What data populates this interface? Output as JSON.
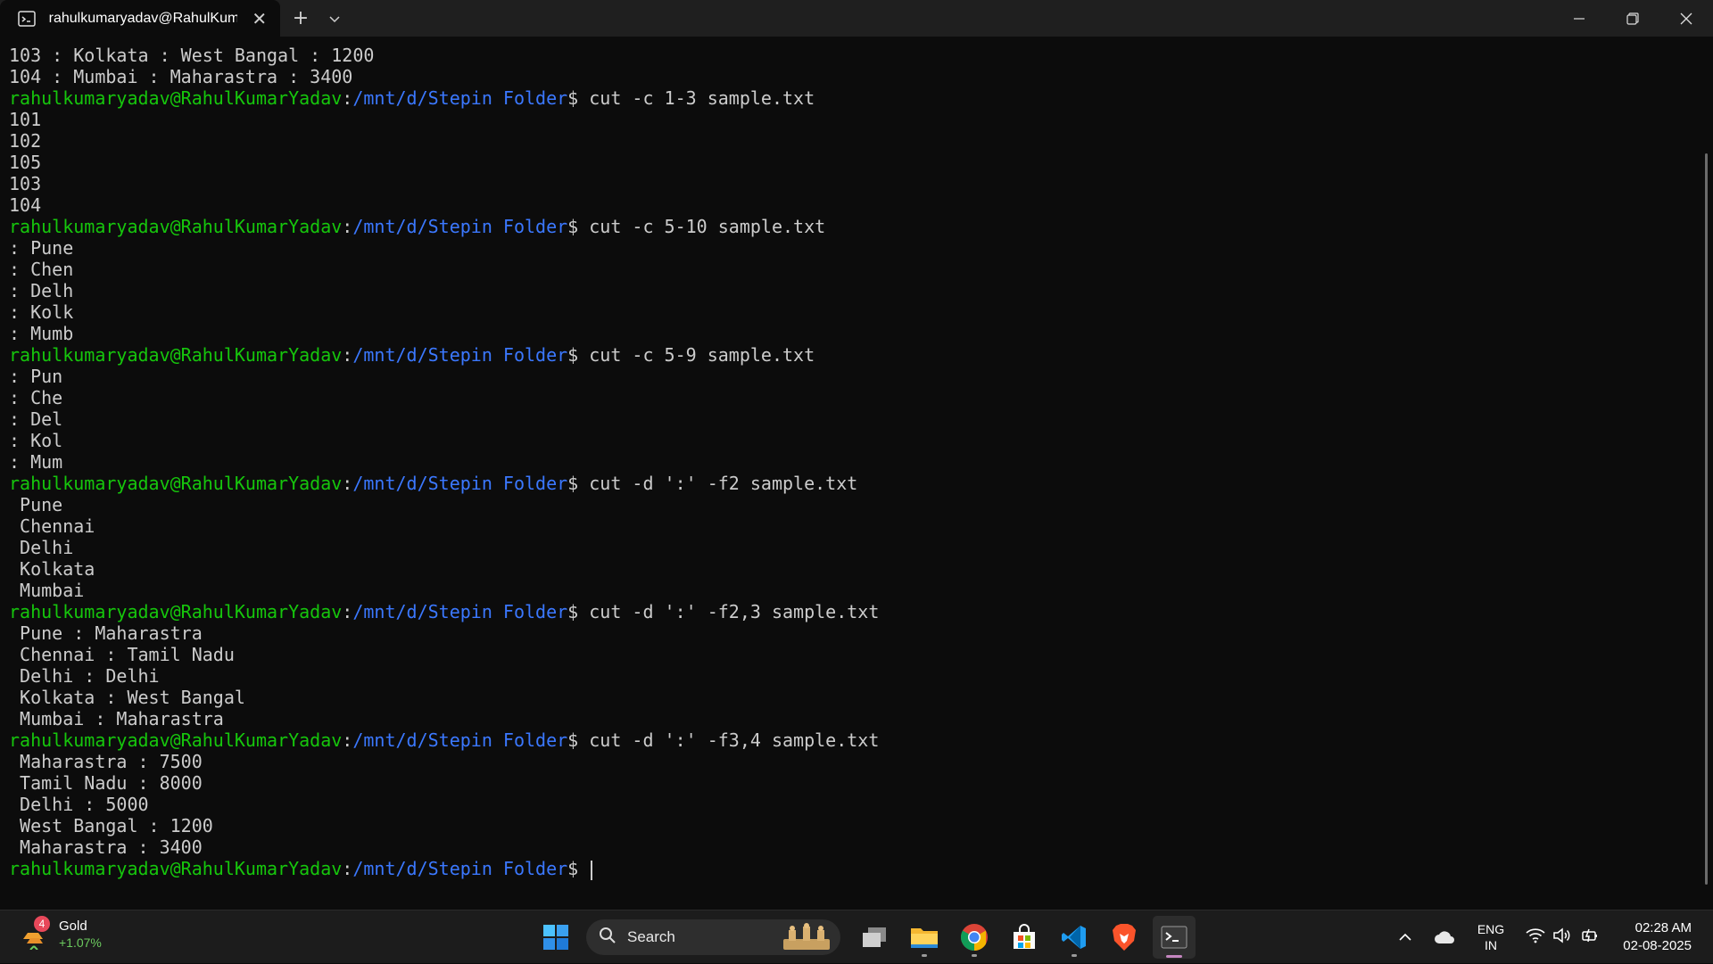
{
  "window": {
    "tab_title": "rahulkumaryadav@RahulKum",
    "tab_icon": "terminal-icon",
    "new_tab_label": "+",
    "dropdown_icon": "chevron-down-icon",
    "controls": [
      "minimize-icon",
      "restore-icon",
      "close-icon"
    ]
  },
  "prompt": {
    "user": "rahulkumaryadav@RahulKumarYadav",
    "sep": ":",
    "path": "/mnt/d/Stepin Folder",
    "symbol": "$ "
  },
  "terminal": {
    "lines": [
      {
        "type": "out",
        "text": "103 : Kolkata : West Bangal : 1200"
      },
      {
        "type": "out",
        "text": "104 : Mumbai : Maharastra : 3400"
      },
      {
        "type": "cmd",
        "text": "cut -c 1-3 sample.txt"
      },
      {
        "type": "out",
        "text": "101"
      },
      {
        "type": "out",
        "text": "102"
      },
      {
        "type": "out",
        "text": "105"
      },
      {
        "type": "out",
        "text": "103"
      },
      {
        "type": "out",
        "text": "104"
      },
      {
        "type": "cmd",
        "text": "cut -c 5-10 sample.txt"
      },
      {
        "type": "out",
        "text": ": Pune"
      },
      {
        "type": "out",
        "text": ": Chen"
      },
      {
        "type": "out",
        "text": ": Delh"
      },
      {
        "type": "out",
        "text": ": Kolk"
      },
      {
        "type": "out",
        "text": ": Mumb"
      },
      {
        "type": "cmd",
        "text": "cut -c 5-9 sample.txt"
      },
      {
        "type": "out",
        "text": ": Pun"
      },
      {
        "type": "out",
        "text": ": Che"
      },
      {
        "type": "out",
        "text": ": Del"
      },
      {
        "type": "out",
        "text": ": Kol"
      },
      {
        "type": "out",
        "text": ": Mum"
      },
      {
        "type": "cmd",
        "text": "cut -d ':' -f2 sample.txt"
      },
      {
        "type": "out",
        "text": " Pune"
      },
      {
        "type": "out",
        "text": " Chennai"
      },
      {
        "type": "out",
        "text": " Delhi"
      },
      {
        "type": "out",
        "text": " Kolkata"
      },
      {
        "type": "out",
        "text": " Mumbai"
      },
      {
        "type": "cmd",
        "text": "cut -d ':' -f2,3 sample.txt"
      },
      {
        "type": "out",
        "text": " Pune : Maharastra"
      },
      {
        "type": "out",
        "text": " Chennai : Tamil Nadu"
      },
      {
        "type": "out",
        "text": " Delhi : Delhi"
      },
      {
        "type": "out",
        "text": " Kolkata : West Bangal"
      },
      {
        "type": "out",
        "text": " Mumbai : Maharastra"
      },
      {
        "type": "cmd",
        "text": "cut -d ':' -f3,4 sample.txt"
      },
      {
        "type": "out",
        "text": " Maharastra : 7500"
      },
      {
        "type": "out",
        "text": " Tamil Nadu : 8000"
      },
      {
        "type": "out",
        "text": " Delhi : 5000"
      },
      {
        "type": "out",
        "text": " West Bangal : 1200"
      },
      {
        "type": "out",
        "text": " Maharastra : 3400"
      },
      {
        "type": "cmd",
        "text": "",
        "cursor": true
      }
    ]
  },
  "taskbar": {
    "widget": {
      "badge": "4",
      "title": "Gold",
      "change": "+1.07%"
    },
    "search_label": "Search",
    "apps": [
      "windows-start-icon",
      "search",
      "task-view-icon",
      "file-explorer-icon",
      "chrome-icon",
      "microsoft-store-icon",
      "vscode-icon",
      "brave-icon",
      "terminal-app-icon"
    ],
    "tray": {
      "lang_top": "ENG",
      "lang_bottom": "IN",
      "time": "02:28 AM",
      "date": "02-08-2025"
    }
  },
  "colors": {
    "user": "#16c60c",
    "path": "#3b78ff",
    "text": "#cccccc",
    "background": "#0c0c0c"
  }
}
